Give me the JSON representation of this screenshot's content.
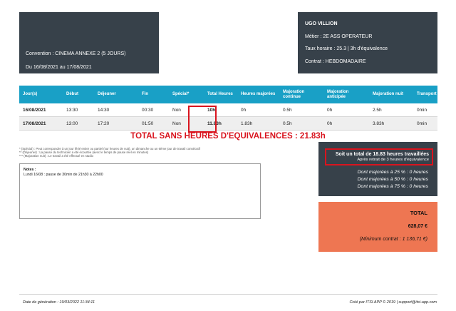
{
  "header_left": {
    "convention": "Convention : CINEMA ANNEXE 2 (5 JOURS)",
    "period": "Du 16/08/2021 au 17/08/2021"
  },
  "header_right": {
    "name": "UGO VILLION",
    "job": "Métier : 2E ASS OPERATEUR",
    "rate": "Taux horaire : 25.3 | 3h d'équivalence",
    "contract": "Contrat : HEBDOMADAIRE"
  },
  "table": {
    "columns": [
      "Jour(s)",
      "Début",
      "Déjeuner",
      "Fin",
      "Spécial*",
      "Total Heures",
      "Heures majorées",
      "Majoration continue",
      "Majoration anticipée",
      "Majoration nuit",
      "Transport"
    ],
    "rows": [
      [
        "16/08/2021",
        "13:30",
        "14:30",
        "00:30",
        "Non",
        "10h",
        "0h",
        "0.5h",
        "0h",
        "2.5h",
        "0min"
      ],
      [
        "17/08/2021",
        "13:00",
        "17:20",
        "01:50",
        "Non",
        "11.83h",
        "1.83h",
        "0.5h",
        "0h",
        "3.83h",
        "0min"
      ]
    ]
  },
  "total_title": "TOTAL SANS HEURES D'EQUIVALENCES : 21.83h",
  "legend": [
    "* (Spécial) : Peut correspondre à un jour férié entier ou partiel (sur heures de nuit), un dimanche ou un 6ème jour de travail consécutif",
    "** (Déjeuner) : La pause du technicien a été écourtée (avec le temps de pause réel en minutes)",
    "*** (Majoration nuit) : Le travail a été effectué en studio"
  ],
  "notes": {
    "title": "Notes :",
    "content": "Lundi 16/08 : pause de 30min de 21h30 à 22h00"
  },
  "summary": {
    "total_line": "Soit un total de 18.83 heures travaillées",
    "subline": "Après retrait de 3 heures d'équivalence",
    "details": [
      "Dont majorées à 25 % : 0 heures",
      "Dont majorées à 50 % : 0 heures",
      "Dont majorées à 75 % : 0 heures"
    ]
  },
  "total_box": {
    "label": "TOTAL",
    "amount": "628,07 €",
    "minimum": "(Minimum contrat : 1 136,71 €)"
  },
  "footer": {
    "generated": "Date de génération : 19/03/2022 11:34:11",
    "credit": "Créé par ITSI APP © 2019 | support@itsi-app.com"
  },
  "colors": {
    "dark_panel": "#37414a",
    "table_header": "#19a0c6",
    "highlight_red": "#d9141e",
    "total_box": "#ee7652"
  }
}
